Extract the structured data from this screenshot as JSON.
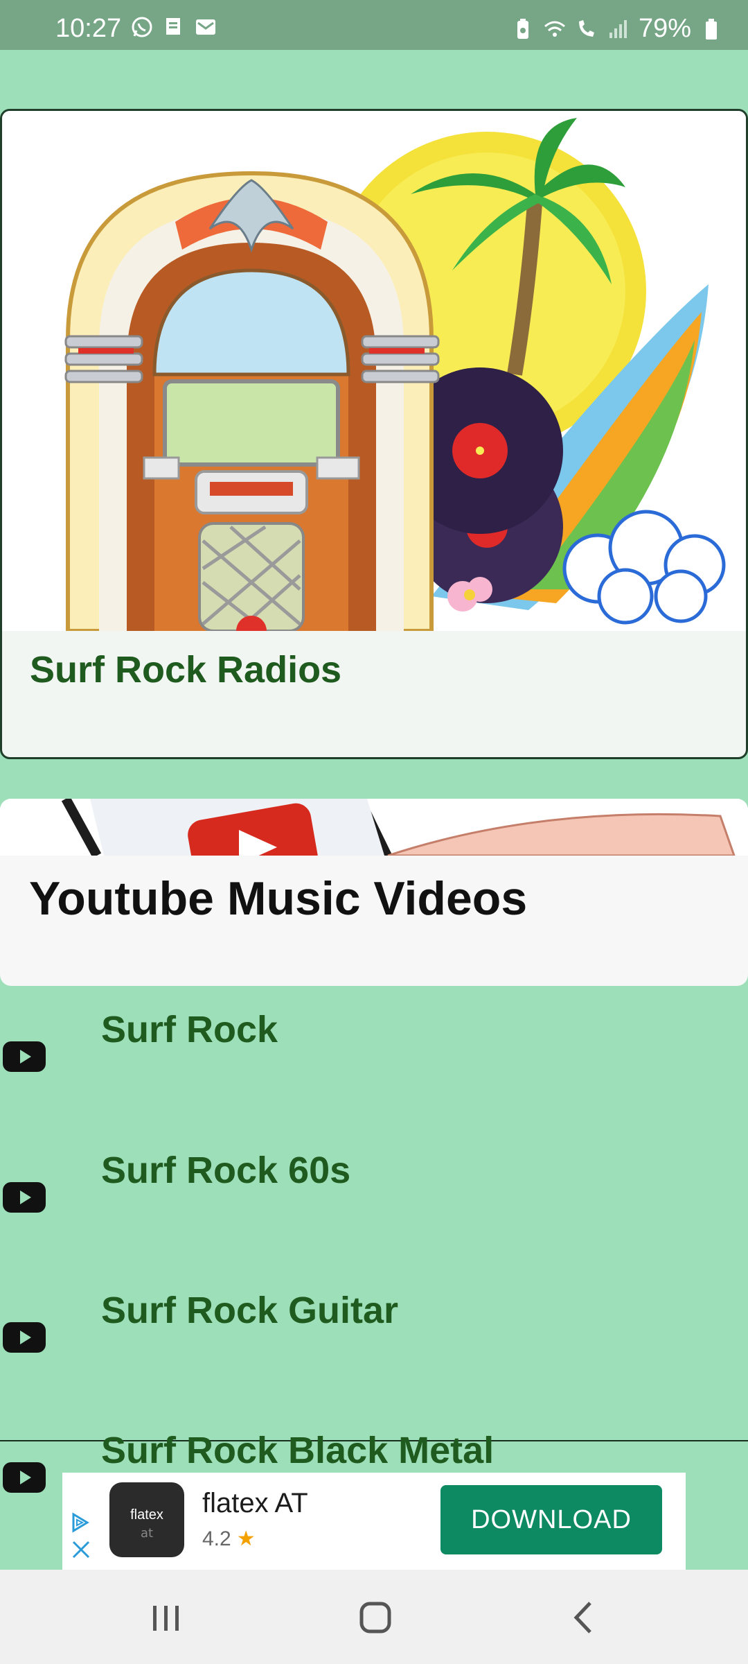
{
  "status_bar": {
    "time": "10:27",
    "battery": "79%",
    "icons_left": [
      "whatsapp-icon",
      "notes-icon",
      "mail-icon"
    ],
    "icons_right": [
      "battery-saver-icon",
      "wifi-icon",
      "wifi-calling-icon",
      "signal-icon",
      "battery-icon"
    ]
  },
  "radio_card": {
    "title": "Surf Rock Radios",
    "image": "jukebox-surf-illustration"
  },
  "youtube_card": {
    "title": "Youtube Music Videos",
    "image": "phone-youtube-illustration"
  },
  "videos": [
    {
      "label": "Surf Rock",
      "icon": "youtube-play-icon"
    },
    {
      "label": "Surf Rock 60s",
      "icon": "youtube-play-icon"
    },
    {
      "label": "Surf Rock Guitar",
      "icon": "youtube-play-icon"
    },
    {
      "label": "Surf Rock Black Metal",
      "icon": "youtube-play-icon"
    }
  ],
  "ad": {
    "app_name": "flatex AT",
    "rating": "4.2",
    "button": "DOWNLOAD",
    "logo_text": "flatex",
    "logo_sub": "at"
  },
  "nav": {
    "buttons": [
      "recents-icon",
      "home-icon",
      "back-icon"
    ]
  },
  "colors": {
    "background": "#9ddfb8",
    "title_green": "#1f5a1e",
    "status_bar": "#77a687",
    "download_button": "#0e8a62"
  }
}
